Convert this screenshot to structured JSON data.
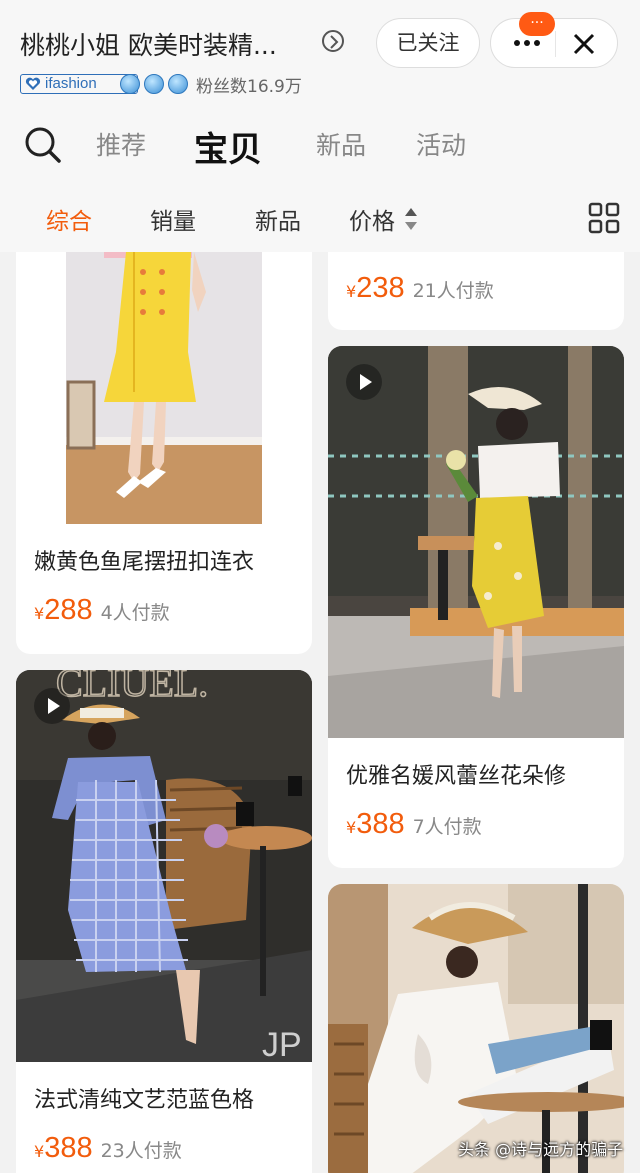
{
  "header": {
    "store_name": "桃桃小姐 欧美时装精...",
    "follow_label": "已关注",
    "notification_badge": "···",
    "brand_badge": "ifashion",
    "fans_text": "粉丝数16.9万"
  },
  "nav_tabs": [
    {
      "label": "推荐"
    },
    {
      "label": "宝贝"
    },
    {
      "label": "新品"
    },
    {
      "label": "活动"
    }
  ],
  "sort_options": [
    {
      "label": "综合"
    },
    {
      "label": "销量"
    },
    {
      "label": "新品"
    },
    {
      "label": "价格"
    }
  ],
  "products": [
    {
      "title": "嫩黄色鱼尾摆扭扣连衣",
      "currency": "¥",
      "price": "288",
      "sold": "4人付款"
    },
    {
      "title": "",
      "currency": "¥",
      "price": "238",
      "sold": "21人付款"
    },
    {
      "title": "优雅名媛风蕾丝花朵修",
      "currency": "¥",
      "price": "388",
      "sold": "7人付款"
    },
    {
      "title": "法式清纯文艺范蓝色格",
      "currency": "¥",
      "price": "388",
      "sold": "23人付款"
    },
    {
      "title": "",
      "currency": "",
      "price": "",
      "sold": ""
    }
  ],
  "image_text": {
    "cliuel": "CLIUEL.",
    "jp": "JP"
  },
  "watermark": "头条 @诗与远方的骗子",
  "colors": {
    "accent": "#f25c0c",
    "badge": "#ff5a14",
    "brand_blue": "#2f6fb8"
  }
}
